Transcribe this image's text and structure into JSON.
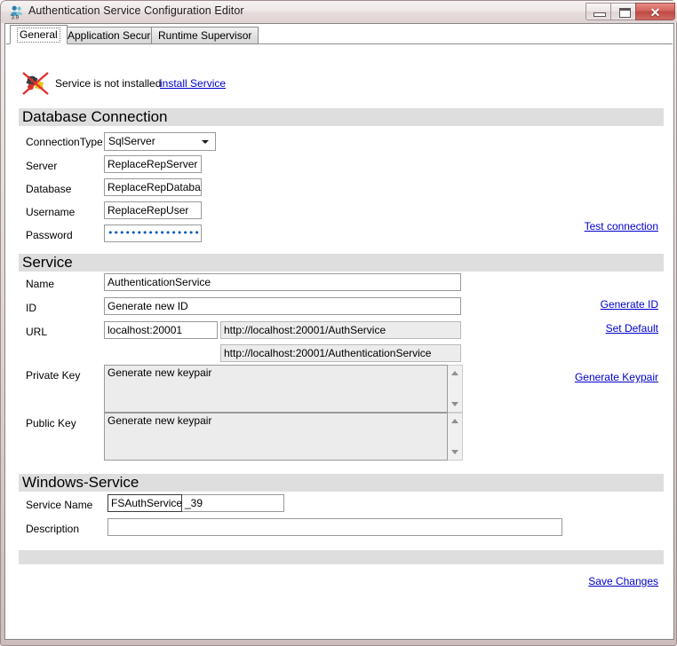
{
  "window": {
    "title": "Authentication Service Configuration Editor",
    "app_icon": "people-39-icon",
    "version_badge": "3.9",
    "buttons": {
      "minimize": "minimize-icon",
      "maximize": "maximize-icon",
      "close": "✕"
    }
  },
  "tabs": [
    {
      "label": "General",
      "active": true
    },
    {
      "label": "Application Security",
      "active": false
    },
    {
      "label": "Runtime Supervisor",
      "active": false
    }
  ],
  "status": {
    "icon": "gears-disabled-icon",
    "text": "Service is not installed",
    "action_link": "install Service"
  },
  "sections": {
    "database": {
      "title": "Database Connection",
      "fields": {
        "connection_type_label": "ConnectionType",
        "connection_type_value": "SqlServer",
        "connection_type_options": [
          "SqlServer"
        ],
        "server_label": "Server",
        "server_value": "ReplaceRepServer",
        "database_label": "Database",
        "database_value": "ReplaceRepDataba",
        "username_label": "Username",
        "username_value": "ReplaceRepUser",
        "password_label": "Password",
        "password_value": "••••••••••••••••••"
      },
      "test_link": "Test connection"
    },
    "service": {
      "title": "Service",
      "fields": {
        "name_label": "Name",
        "name_value": "AuthenticationService",
        "id_label": "ID",
        "id_value": "Generate new ID",
        "url_label": "URL",
        "url_host_value": "localhost:20001",
        "url_preview_1": "http://localhost:20001/AuthService",
        "url_preview_2": "http://localhost:20001/AuthenticationService",
        "private_key_label": "Private Key",
        "private_key_value": "Generate new keypair",
        "public_key_label": "Public Key",
        "public_key_value": "Generate new keypair"
      },
      "links": {
        "generate_id": "Generate ID",
        "set_default": "Set Default",
        "generate_keypair": "Generate Keypair"
      }
    },
    "windows_service": {
      "title": "Windows-Service",
      "fields": {
        "service_name_label": "Service Name",
        "service_name_value": "FSAuthService",
        "service_name_suffix": "_39",
        "description_label": "Description",
        "description_value": ""
      }
    }
  },
  "footer": {
    "save_link": "Save Changes"
  },
  "colors": {
    "link": "#0000cd",
    "section_header_bg": "#dedede",
    "readonly_bg": "#ececec",
    "close_button": "#c04f48"
  }
}
